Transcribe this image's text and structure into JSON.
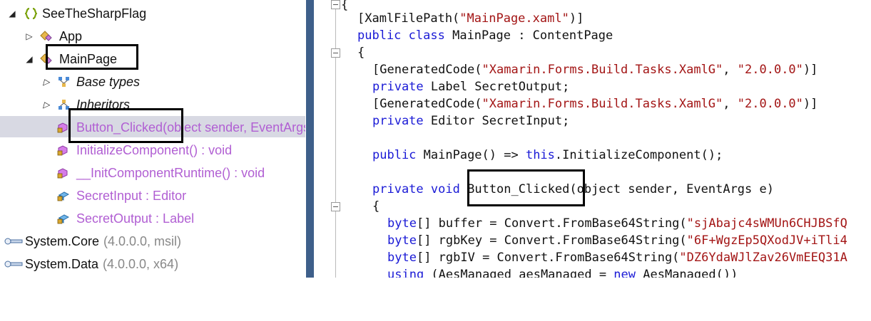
{
  "tree": {
    "root": {
      "label": "SeeTheSharpFlag"
    },
    "app": {
      "label": "App"
    },
    "main_page": {
      "label": "MainPage"
    },
    "base_types": {
      "label": "Base types"
    },
    "inheritors": {
      "label": "Inheritors"
    },
    "members": [
      {
        "label": "Button_Clicked(object sender, EventArgs e) : void"
      },
      {
        "label": "InitializeComponent() : void"
      },
      {
        "label": "__InitComponentRuntime() : void"
      },
      {
        "label": "SecretInput : Editor"
      },
      {
        "label": "SecretOutput : Label"
      }
    ],
    "refs": [
      {
        "name": "System.Core",
        "detail": "(4.0.0.0, msil)"
      },
      {
        "name": "System.Data",
        "detail": "(4.0.0.0, x64)"
      }
    ]
  },
  "code": {
    "l0": "{",
    "l1_a": "[XamlFilePath(",
    "l1_s": "\"MainPage.xaml\"",
    "l1_b": ")]",
    "l2_kw1": "public",
    "l2_kw2": "class",
    "l2_rest": " MainPage : ContentPage",
    "l3": "{",
    "l4_a": "[GeneratedCode(",
    "l4_s1": "\"Xamarin.Forms.Build.Tasks.XamlG\"",
    "l4_m": ", ",
    "l4_s2": "\"2.0.0.0\"",
    "l4_b": ")]",
    "l5_kw": "private",
    "l5_rest": " Label SecretOutput;",
    "l6_a": "[GeneratedCode(",
    "l6_s1": "\"Xamarin.Forms.Build.Tasks.XamlG\"",
    "l6_m": ", ",
    "l6_s2": "\"2.0.0.0\"",
    "l6_b": ")]",
    "l7_kw": "private",
    "l7_rest": " Editor SecretInput;",
    "l8_kw": "public",
    "l8_a": " MainPage() => ",
    "l8_kw2": "this",
    "l8_b": ".InitializeComponent();",
    "l9_kw1": "private",
    "l9_kw2": "void",
    "l9_name": "Button_Clicked",
    "l9_rest": "(object sender, EventArgs e)",
    "l10": "{",
    "l11_kw": "byte",
    "l11_a": "[] buffer = Convert.FromBase64String(",
    "l11_s": "\"sjAbajc4sWMUn6CHJBSfQ",
    "l12_kw": "byte",
    "l12_a": "[] rgbKey = Convert.FromBase64String(",
    "l12_s": "\"6F+WgzEp5QXodJV+iTli4",
    "l13_kw": "byte",
    "l13_a": "[] rgbIV = Convert.FromBase64String(",
    "l13_s": "\"DZ6YdaWJlZav26VmEEQ31A",
    "l14_kw": "using",
    "l14_a": " (AesManaged aesManaged = ",
    "l14_kw2": "new",
    "l14_b": " AesManaged())"
  },
  "colors": {
    "keyword": "#1a1ad6",
    "string": "#a31515",
    "member": "#b15fd3",
    "divider": "#3e5f8a",
    "selection": "#d6d7e2"
  }
}
